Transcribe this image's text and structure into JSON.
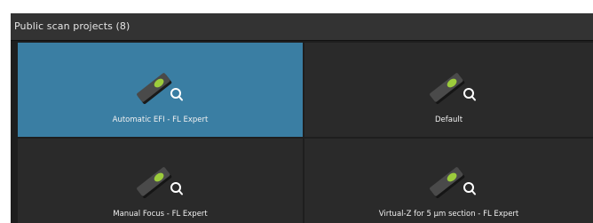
{
  "panel": {
    "title": "Public scan projects (8)"
  },
  "tiles": [
    {
      "label": "Automatic EFI - FL Expert",
      "icon": "slide-search-icon",
      "selected": true
    },
    {
      "label": "Default",
      "icon": "slide-search-icon",
      "selected": false
    },
    {
      "label": "Manual Focus - FL Expert",
      "icon": "slide-search-icon",
      "selected": false
    },
    {
      "label": "Virtual-Z for 5 µm section - FL Expert",
      "icon": "slide-search-icon",
      "selected": false
    }
  ],
  "colors": {
    "selected_tile": "#3a7ea3",
    "tile": "#2a2a2a",
    "header": "#333333",
    "slide_dot": "#9ccc3c"
  }
}
